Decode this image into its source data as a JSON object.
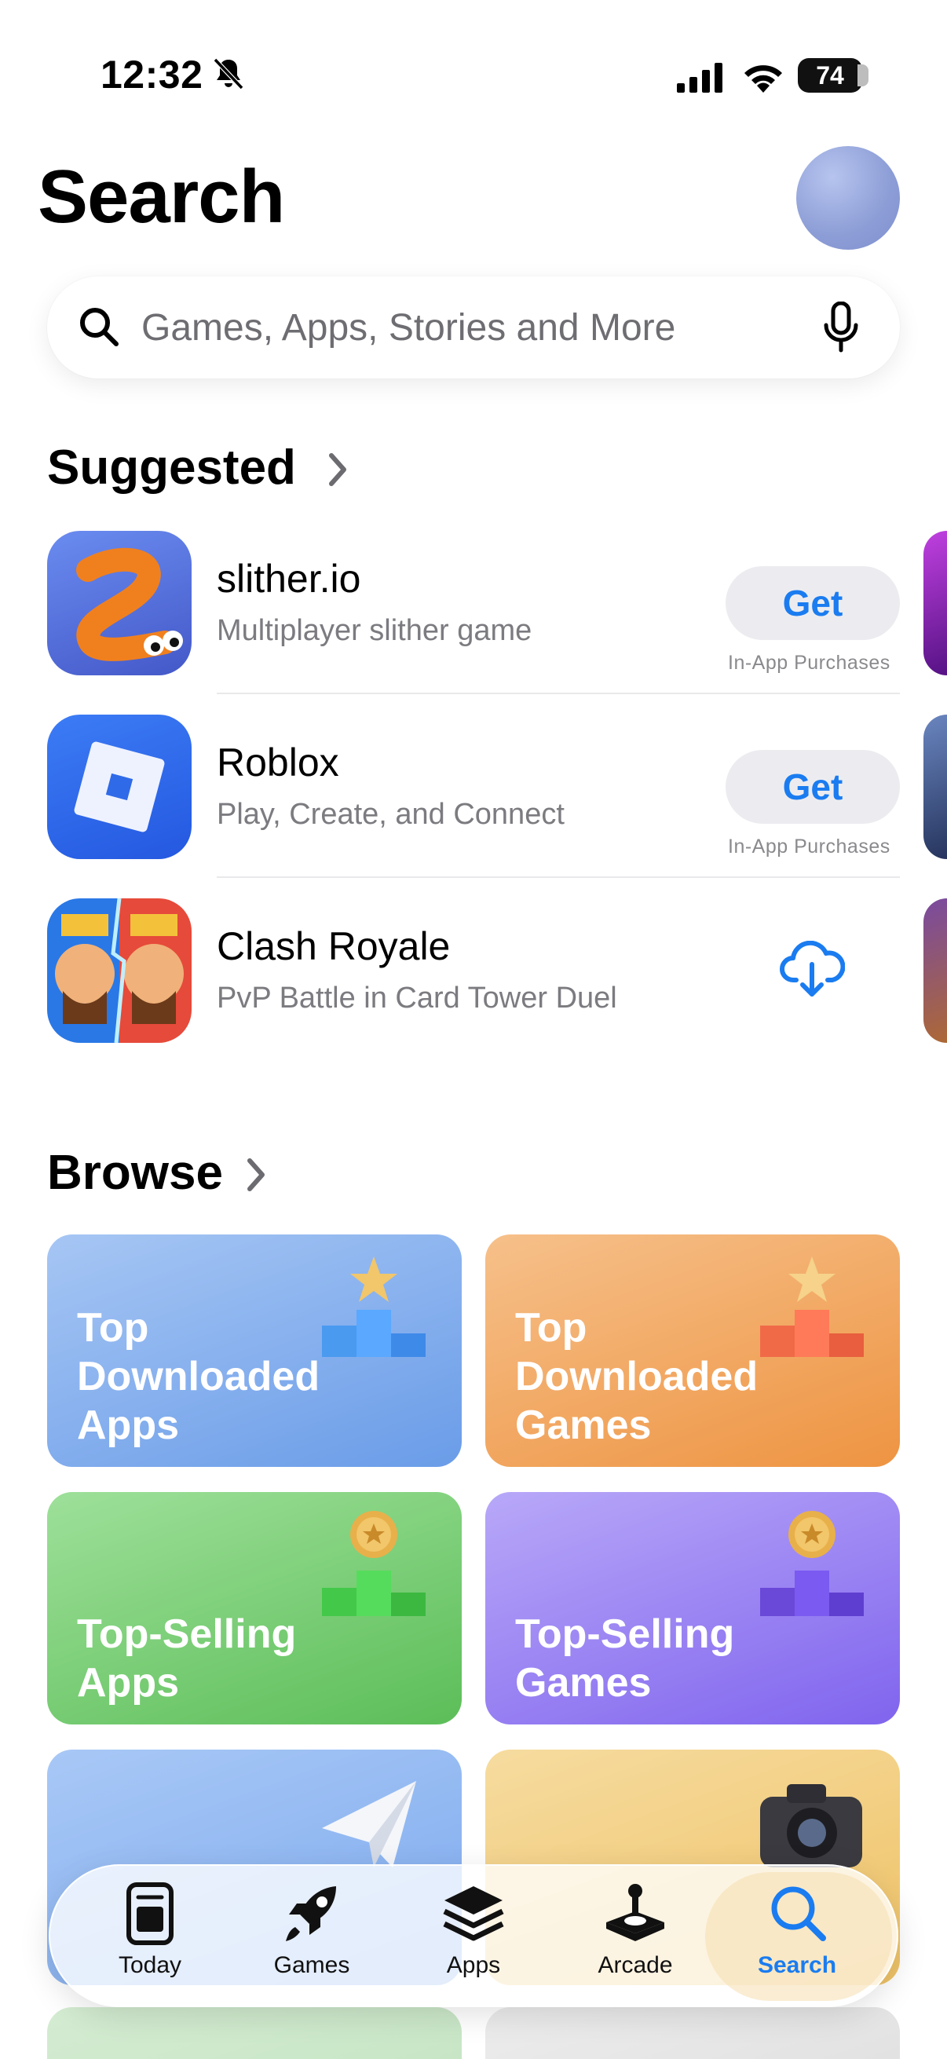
{
  "status_bar": {
    "time": "12:32",
    "battery": "74"
  },
  "header": {
    "title": "Search"
  },
  "search": {
    "placeholder": "Games, Apps, Stories and More"
  },
  "suggested": {
    "title": "Suggested",
    "apps": [
      {
        "name": "slither.io",
        "subtitle": "Multiplayer slither game",
        "action": "Get",
        "note": "In-App Purchases"
      },
      {
        "name": "Roblox",
        "subtitle": "Play, Create, and Connect",
        "action": "Get",
        "note": "In-App Purchases"
      },
      {
        "name": "Clash Royale",
        "subtitle": "PvP Battle in Card Tower Duel",
        "action_icon": "cloud-download-icon"
      }
    ]
  },
  "browse": {
    "title": "Browse",
    "cards": [
      {
        "label": "Top\nDownloaded\nApps",
        "color": "#79a6e8"
      },
      {
        "label": "Top\nDownloaded\nGames",
        "color": "#f0a060"
      },
      {
        "label": "Top-Selling\nApps",
        "color": "#68c466"
      },
      {
        "label": "Top-Selling\nGames",
        "color": "#8a6ef0"
      }
    ]
  },
  "tabs": [
    {
      "label": "Today",
      "icon": "today-icon"
    },
    {
      "label": "Games",
      "icon": "rocket-icon"
    },
    {
      "label": "Apps",
      "icon": "stack-icon"
    },
    {
      "label": "Arcade",
      "icon": "joystick-icon"
    },
    {
      "label": "Search",
      "icon": "search-icon",
      "active": true
    }
  ],
  "colors": {
    "accent": "#1a7cf0"
  }
}
